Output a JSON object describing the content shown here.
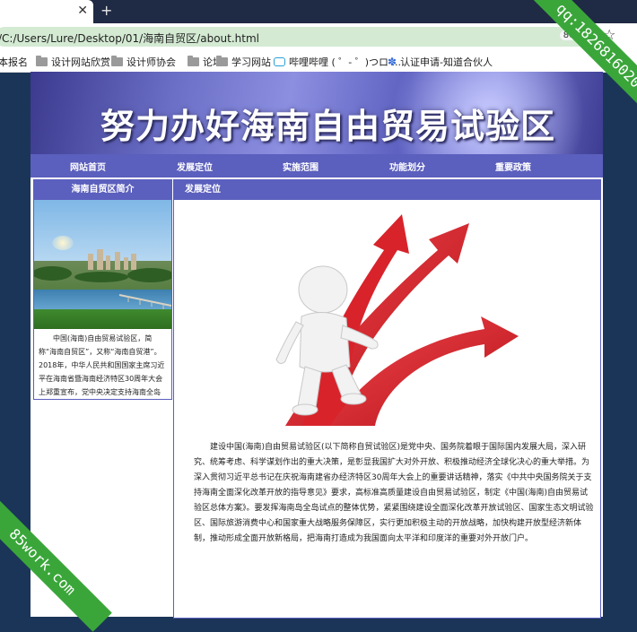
{
  "browser": {
    "url": "/C:/Users/Lure/Desktop/01/海南自贸区/about.html",
    "zoom": "80%",
    "bookmarks": [
      "本报名",
      "设计网站欣赏",
      "设计师协会",
      "论坛",
      "学习网站",
      "哔哩哔哩 ( ゜- ゜)つロ ...",
      "认证申请-知道合伙人"
    ]
  },
  "banner": {
    "title": "努力办好海南自由贸易试验区"
  },
  "nav": {
    "items": [
      "网站首页",
      "发展定位",
      "实施范围",
      "功能划分",
      "重要政策"
    ]
  },
  "sidebar": {
    "title": "海南自贸区简介",
    "text": "中国(海南)自由贸易试验区，简称“海南自贸区”，又称“海南自贸港”。2018年，中华人民共和国国家主席习近平在海南省暨海南经济特区30周年大会上郑重宣布，党中央决定支持海南全岛建设自由贸易试验区。"
  },
  "content": {
    "title": "发展定位",
    "paragraph": "建设中国(海南)自由贸易试验区(以下简称自贸试验区)是党中央、国务院着眼于国际国内发展大局，深入研究、统筹考虑、科学谋划作出的重大决策，是彰显我国扩大对外开放、积极推动经济全球化决心的重大举措。为深入贯彻习近平总书记在庆祝海南建省办经济特区30周年大会上的重要讲话精神，落实《中共中央国务院关于支持海南全面深化改革开放的指导意见》要求，高标准高质量建设自由贸易试验区，制定《中国(海南)自由贸易试验区总体方案》。要发挥海南岛全岛试点的整体优势，紧紧围绕建设全面深化改革开放试验区、国家生态文明试验区、国际旅游消费中心和国家重大战略服务保障区，实行更加积极主动的开放战略，加快构建开放型经济新体制，推动形成全面开放新格局，把海南打造成为我国面向太平洋和印度洋的重要对外开放门户。"
  },
  "watermarks": {
    "top_right": "qq:1826816020",
    "bottom_left": "85work.com"
  },
  "colors": {
    "nav": "#5b5fbd",
    "url_bar": "#d4ead3",
    "watermark": "#3aa63a",
    "arrow": "#e0242b"
  }
}
